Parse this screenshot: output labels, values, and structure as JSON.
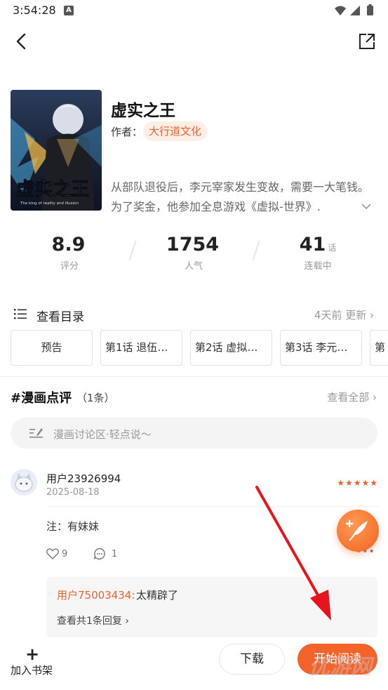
{
  "status_bar": {
    "time": "3:54:28",
    "notification_letter": "A"
  },
  "book": {
    "title": "虚实之王",
    "author_label": "作者：",
    "author": "大行道文化",
    "cover_text": "虚实之王",
    "cover_subtitle": "The king of reality and illusion",
    "synopsis": "从部队退役后，李元宰家发生变故，需要一大笔钱。为了奖金，他参加全息游戏《虚拟-世界》."
  },
  "stats": [
    {
      "value": "8.9",
      "unit": "",
      "label": "评分"
    },
    {
      "value": "1754",
      "unit": "",
      "label": "人气"
    },
    {
      "value": "41",
      "unit": "话",
      "label": "连载中"
    }
  ],
  "catalog": {
    "title": "查看目录",
    "update": "4天前 更新 ›",
    "chapters": [
      "预告",
      "第1话 退伍后…",
      "第2话 虚拟世…",
      "第3话 李元宰…",
      "第"
    ]
  },
  "comments": {
    "title": "#漫画点评",
    "count": "（1条）",
    "view_all": "查看全部 ›",
    "input_placeholder": "漫画讨论区·轻点说～",
    "items": [
      {
        "user": "用户23926994",
        "date": "2025-08-18",
        "stars": "★★★★★",
        "text": "注：有妹妹",
        "likes": "9",
        "replies": "1",
        "reply_user": "用户75003434:",
        "reply_text": "太精辟了",
        "reply_more": "查看共1条回复 ›"
      }
    ]
  },
  "bottom": {
    "shelf_icon": "+",
    "shelf_label": "加入书架",
    "download": "下载",
    "start_read": "开始阅读"
  },
  "watermark": "优游网",
  "colors": {
    "accent": "#f4632a",
    "chip_bg": "#fdeee6",
    "arrow": "#e8141b"
  }
}
